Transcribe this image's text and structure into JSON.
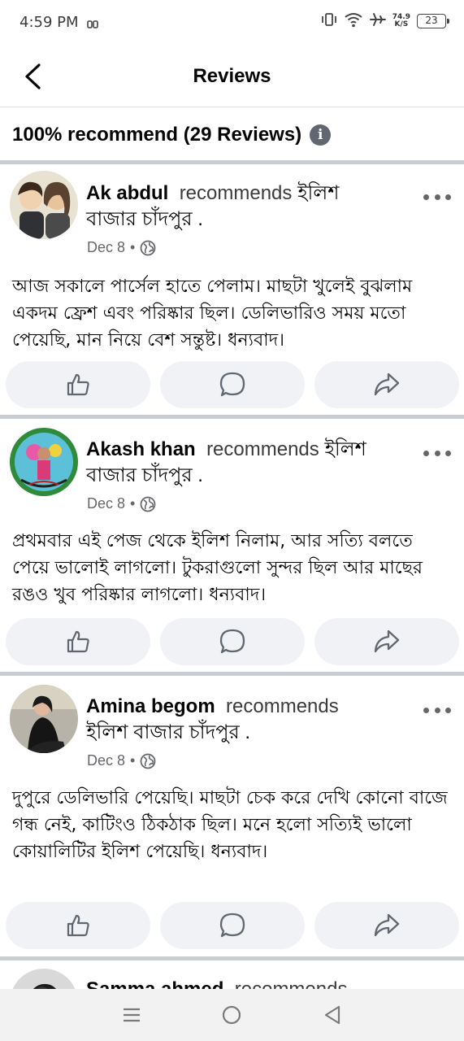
{
  "status_bar": {
    "time": "4:59 PM",
    "net_speed_value": "74.9",
    "net_speed_unit": "K/S",
    "battery": "23"
  },
  "header": {
    "title": "Reviews"
  },
  "summary": {
    "text": "100% recommend (29 Reviews)"
  },
  "reviews": [
    {
      "name": "Ak abdul",
      "verb": "recommends",
      "page_inline": "ইলিশ",
      "page_rest": "বাজার চাঁদপুর .",
      "date": "Dec 8",
      "text": "আজ সকালে পার্সেল হাতে পেলাম। মাছটা খুলেই বুঝলাম একদম ফ্রেশ এবং পরিষ্কার ছিল। ডেলিভারিও সময় মতো পেয়েছি, মান নিয়ে বেশ সন্তুষ্ট। ধন্যবাদ।"
    },
    {
      "name": "Akash khan",
      "verb": "recommends",
      "page_inline": "ইলিশ",
      "page_rest": "বাজার চাঁদপুর .",
      "date": "Dec 8",
      "text": "প্রথমবার এই পেজ থেকে ইলিশ নিলাম, আর সত্যি বলতে পেয়ে ভালোই লাগলো। টুকরাগুলো সুন্দর ছিল আর মাছের রঙও খুব পরিষ্কার লাগলো। ধন্যবাদ।"
    },
    {
      "name": "Amina begom",
      "verb": "recommends",
      "page_inline": "",
      "page_rest": "ইলিশ বাজার চাঁদপুর .",
      "date": "Dec 8",
      "text": "দুপুরে ডেলিভারি পেয়েছি। মাছটা চেক করে দেখি কোনো বাজে গন্ধ নেই, কাটিংও ঠিকঠাক ছিল। মনে হলো সত্যিই ভালো কোয়ালিটির ইলিশ পেয়েছি। ধন্যবাদ।"
    },
    {
      "name": "Samma ahmed",
      "verb": "recommends"
    }
  ],
  "colors": {
    "action_bg": "#f0f2f5",
    "separator": "#c9ccd1",
    "secondary_text": "#65676b"
  },
  "icons": {
    "like": "thumbs-up-icon",
    "comment": "comment-icon",
    "share": "share-icon",
    "audience": "globe-icon",
    "more": "more-dots-icon"
  }
}
